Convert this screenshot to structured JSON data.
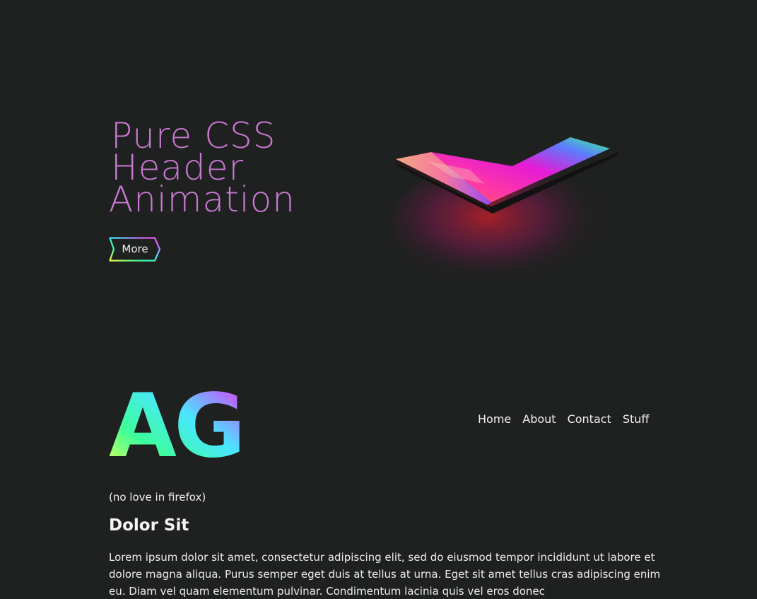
{
  "hero": {
    "title_lines": [
      "Pure CSS",
      "Header",
      "Animation"
    ],
    "more_label": "More"
  },
  "logo": {
    "text": "AG"
  },
  "nav": {
    "items": [
      {
        "label": "Home"
      },
      {
        "label": "About"
      },
      {
        "label": "Contact"
      },
      {
        "label": "Stuff"
      }
    ]
  },
  "content": {
    "note": "(no love in firefox)",
    "section_title": "Dolor Sit",
    "paragraph": "Lorem ipsum dolor sit amet, consectetur adipiscing elit, sed do eiusmod tempor incididunt ut labore et dolore magna aliqua. Purus semper eget duis at tellus at urna. Eget sit amet tellus cras adipiscing enim eu. Diam vel quam elementum pulvinar. Condimentum lacinia quis vel eros donec"
  },
  "colors": {
    "background": "#1f2020",
    "title": "#c779d0",
    "gradient": [
      "#f6ff4a",
      "#3dff9a",
      "#49e6ff",
      "#c36bff",
      "#ff4fd8"
    ]
  },
  "icons": {
    "more_badge": "gradient-chevron-badge",
    "laptop": "glowing-laptop-image"
  }
}
